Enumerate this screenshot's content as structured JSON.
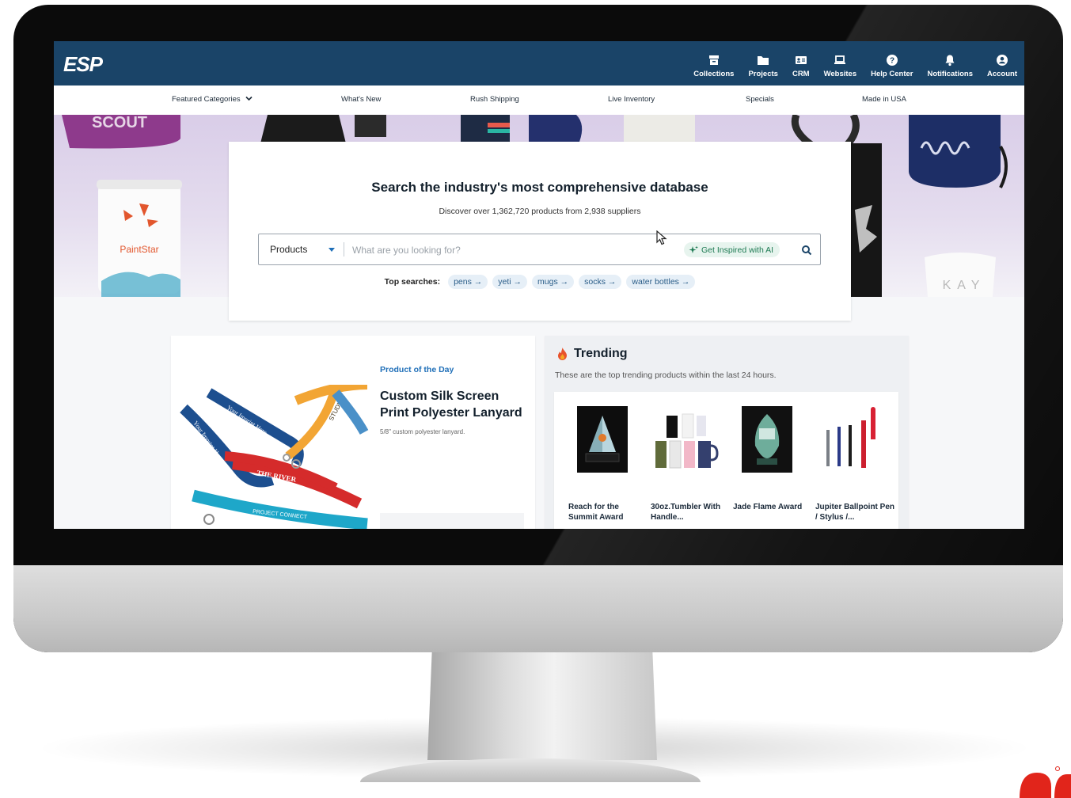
{
  "brand": {
    "logo_text": "ESP"
  },
  "top_nav": [
    {
      "label": "Collections",
      "icon": "archive-icon"
    },
    {
      "label": "Projects",
      "icon": "folder-icon"
    },
    {
      "label": "CRM",
      "icon": "contact-card-icon"
    },
    {
      "label": "Websites",
      "icon": "laptop-icon"
    },
    {
      "label": "Help Center",
      "icon": "help-icon"
    },
    {
      "label": "Notifications",
      "icon": "bell-icon"
    },
    {
      "label": "Account",
      "icon": "user-circle-icon"
    }
  ],
  "category_nav": [
    {
      "label": "Featured Categories"
    },
    {
      "label": "What's New"
    },
    {
      "label": "Rush Shipping"
    },
    {
      "label": "Live Inventory"
    },
    {
      "label": "Specials"
    },
    {
      "label": "Made in USA"
    }
  ],
  "hero": {
    "left_product_brand": "PaintStar",
    "right_bottle_text": "KAY"
  },
  "search": {
    "title": "Search the industry's most comprehensive database",
    "subtitle": "Discover over 1,362,720 products from 2,938 suppliers",
    "scope_selected": "Products",
    "placeholder": "What are you looking for?",
    "ai_button": "Get Inspired with AI",
    "top_searches_label": "Top searches:",
    "top_searches": [
      "pens →",
      "yeti →",
      "mugs →",
      "socks →",
      "water bottles →"
    ]
  },
  "product_of_the_day": {
    "label": "Product of the Day",
    "title": "Custom Silk Screen Print Polyester Lanyard",
    "description": "5/8\" custom polyester lanyard.",
    "image_text": [
      "Your Imprint Here",
      "Your Imprint Here",
      "THE RIVER",
      "ABBEY ROAD",
      "STUDIOS",
      "PROJECT CONNECT"
    ]
  },
  "trending": {
    "title": "Trending",
    "subtitle": "These are the top trending products within the last 24 hours.",
    "items": [
      {
        "name": "Reach for the Summit Award"
      },
      {
        "name": "30oz.Tumbler With Handle..."
      },
      {
        "name": "Jade Flame Award"
      },
      {
        "name": "Jupiter Ballpoint Pen / Stylus /..."
      }
    ]
  },
  "colors": {
    "topbar": "#1a4468",
    "link_blue": "#1f6fb8",
    "ai_green": "#1e7a53",
    "hero_lavender": "#d9cde8"
  }
}
